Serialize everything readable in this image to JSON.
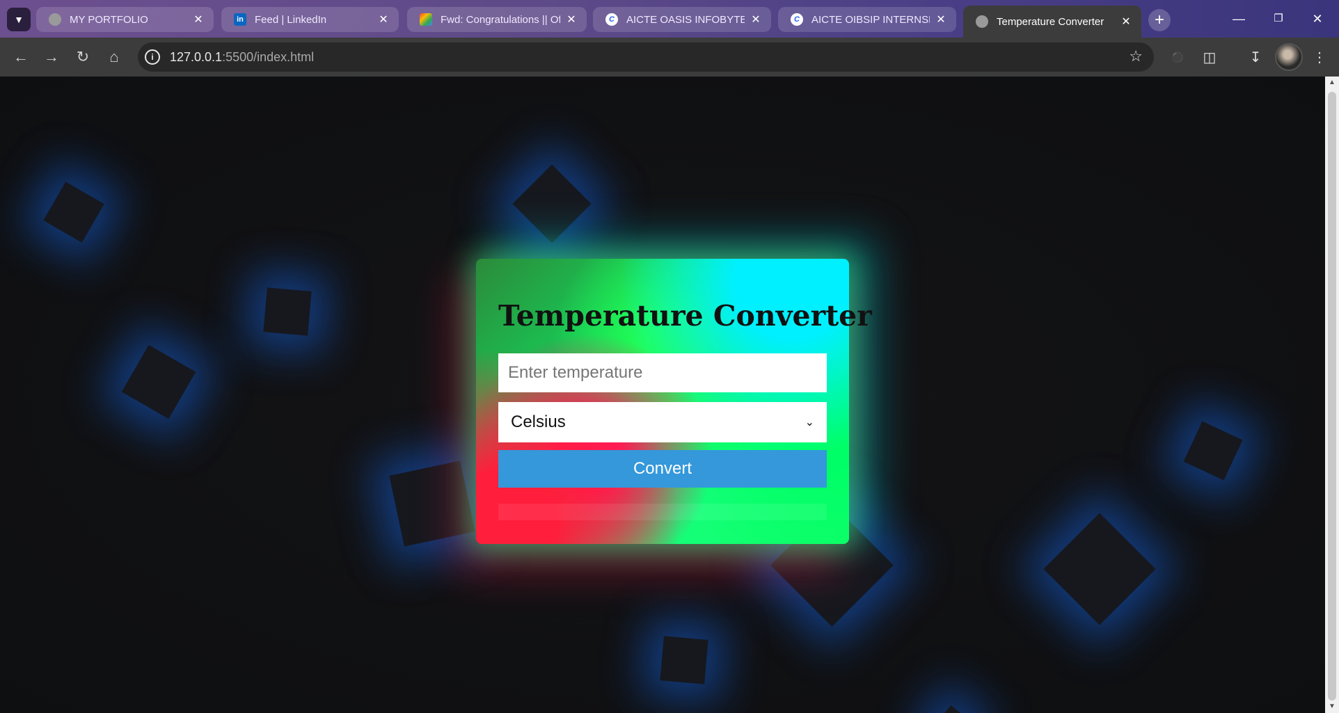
{
  "browser": {
    "tabs": [
      {
        "title": "MY PORTFOLIO",
        "favicon": "globe-icon",
        "active": false
      },
      {
        "title": "Feed | LinkedIn",
        "favicon": "linkedin-icon",
        "active": false
      },
      {
        "title": "Fwd: Congratulations || Off",
        "favicon": "gmail-icon",
        "active": false
      },
      {
        "title": "AICTE OASIS INFOBYTE SIP",
        "favicon": "c-icon",
        "active": false
      },
      {
        "title": "AICTE OIBSIP INTERNSHIP",
        "favicon": "c-icon",
        "active": false
      },
      {
        "title": "Temperature Converter",
        "favicon": "globe-icon",
        "active": true
      }
    ],
    "url_host": "127.0.0.1",
    "url_path": ":5500/index.html"
  },
  "page": {
    "title": "Temperature Converter",
    "input_placeholder": "Enter temperature",
    "input_value": "",
    "unit_selected": "Celsius",
    "convert_label": "Convert",
    "result_text": ""
  },
  "colors": {
    "button": "#3498db",
    "cube_glow": "#146eff"
  }
}
